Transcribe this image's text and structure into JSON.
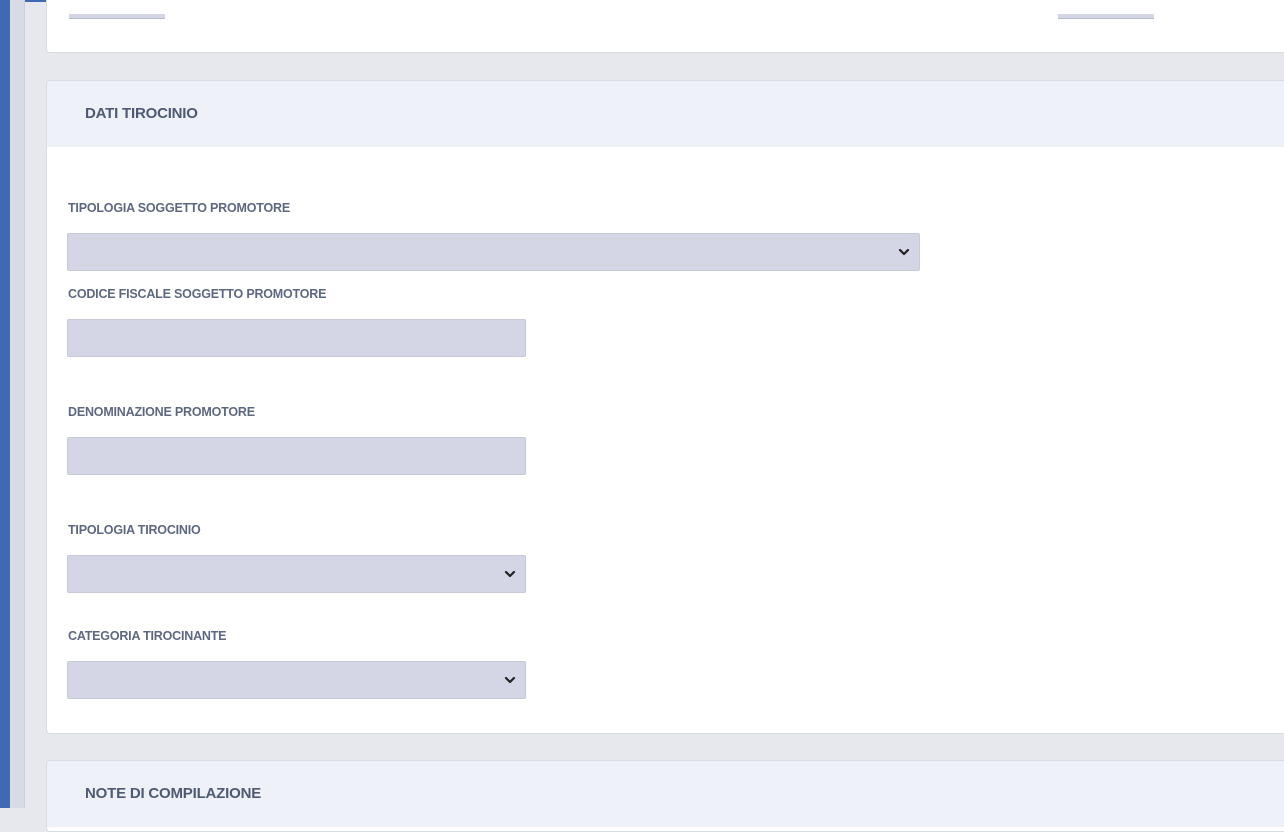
{
  "sections": {
    "dati_tirocinio": {
      "title": "DATI TIROCINIO",
      "fields": {
        "tipologia_soggetto_promotore": {
          "label": "TIPOLOGIA SOGGETTO PROMOTORE",
          "type": "select",
          "value": ""
        },
        "codice_fiscale_soggetto_promotore": {
          "label": "CODICE FISCALE SOGGETTO PROMOTORE",
          "type": "text",
          "value": ""
        },
        "denominazione_promotore": {
          "label": "DENOMINAZIONE PROMOTORE",
          "type": "text",
          "value": ""
        },
        "tipologia_tirocinio": {
          "label": "TIPOLOGIA TIROCINIO",
          "type": "select",
          "value": ""
        },
        "categoria_tirocinante": {
          "label": "CATEGORIA TIROCINANTE",
          "type": "select",
          "value": ""
        }
      }
    },
    "note_di_compilazione": {
      "title": "NOTE DI COMPILAZIONE"
    }
  },
  "icons": {
    "select_chevron": "chevron-down-icon"
  },
  "colors": {
    "frame_blue": "#3f69b3",
    "field_fill": "#d4d6e6",
    "header_fill": "#eef1f8",
    "label_text": "#5d6880"
  }
}
